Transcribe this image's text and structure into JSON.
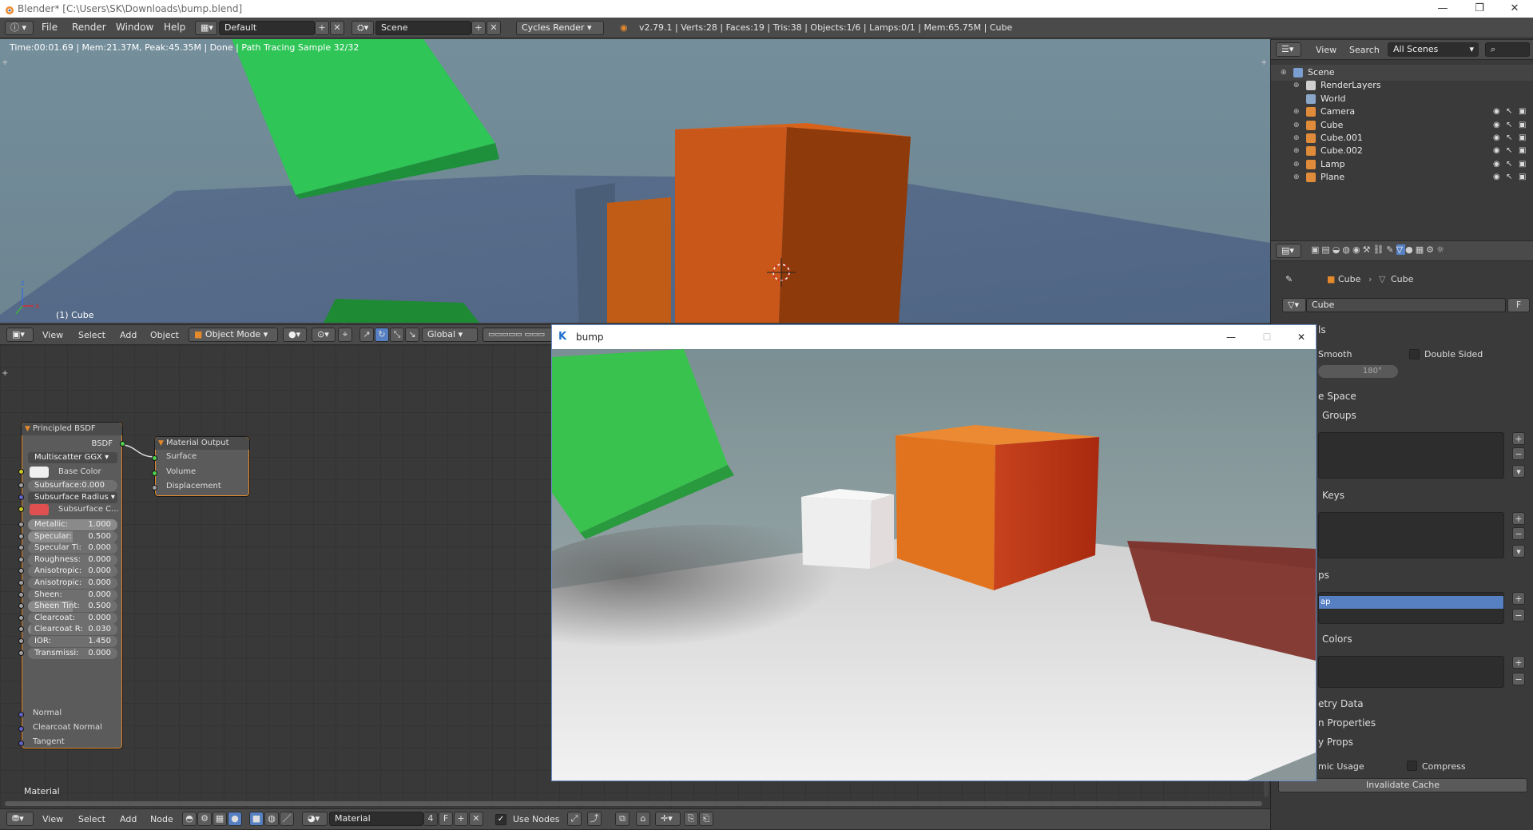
{
  "window": {
    "title": "Blender* [C:\\Users\\SK\\Downloads\\bump.blend]",
    "controls": [
      "—",
      "❐",
      "✕"
    ]
  },
  "info_header": {
    "menus": [
      "File",
      "Render",
      "Window",
      "Help"
    ],
    "layout": "Default",
    "scene": "Scene",
    "engine": "Cycles Render",
    "stats": "v2.79.1 | Verts:28 | Faces:19 | Tris:38 | Objects:1/6 | Lamps:0/1 | Mem:65.75M | Cube"
  },
  "viewport": {
    "render_status": "Time:00:01.69 | Mem:21.37M, Peak:45.35M | Done | Path Tracing Sample 32/32",
    "object_label": "(1) Cube",
    "header": {
      "menus": [
        "View",
        "Select",
        "Add",
        "Object"
      ],
      "mode": "Object Mode",
      "orientation": "Global"
    }
  },
  "node_editor": {
    "label": "Material",
    "principled": {
      "title": "Principled BSDF",
      "output": "BSDF",
      "distribution": "Multiscatter GGX",
      "base_color": "Base Color",
      "subsurface": "Subsurface:",
      "subsurface_val": "0.000",
      "subsurface_radius": "Subsurface Radius",
      "subsurface_color": "Subsurface C...",
      "params": [
        {
          "label": "Metallic:",
          "value": "1.000",
          "fill": 1.0
        },
        {
          "label": "Specular:",
          "value": "0.500",
          "fill": 0.5
        },
        {
          "label": "Specular Ti:",
          "value": "0.000",
          "fill": 0
        },
        {
          "label": "Roughness:",
          "value": "0.000",
          "fill": 0
        },
        {
          "label": "Anisotropic:",
          "value": "0.000",
          "fill": 0
        },
        {
          "label": "Anisotropic:",
          "value": "0.000",
          "fill": 0
        },
        {
          "label": "Sheen:",
          "value": "0.000",
          "fill": 0
        },
        {
          "label": "Sheen Tint:",
          "value": "0.500",
          "fill": 0.5
        },
        {
          "label": "Clearcoat:",
          "value": "0.000",
          "fill": 0
        },
        {
          "label": "Clearcoat R:",
          "value": "0.030",
          "fill": 0.03
        },
        {
          "label": "IOR:",
          "value": "1.450",
          "fill": 0
        },
        {
          "label": "Transmissi:",
          "value": "0.000",
          "fill": 0
        }
      ],
      "inputs": [
        "Normal",
        "Clearcoat Normal",
        "Tangent"
      ]
    },
    "output": {
      "title": "Material Output",
      "sockets": [
        "Surface",
        "Volume",
        "Displacement"
      ]
    },
    "header": {
      "menus": [
        "View",
        "Select",
        "Add",
        "Node"
      ],
      "material": "Material",
      "users": "4",
      "fake": "F",
      "use_nodes": "Use Nodes"
    }
  },
  "outliner": {
    "menus": [
      "View",
      "Search"
    ],
    "filter": "All Scenes",
    "items": [
      {
        "label": "Scene",
        "icon": "scene-icon",
        "color": "#7a9fd0"
      },
      {
        "label": "RenderLayers",
        "icon": "render-layers-icon",
        "color": "#cfcfcf"
      },
      {
        "label": "World",
        "icon": "world-icon",
        "color": "#8aa7c9"
      },
      {
        "label": "Camera",
        "icon": "camera-icon",
        "color": "#e08b3a"
      },
      {
        "label": "Cube",
        "icon": "mesh-icon",
        "color": "#e08b3a"
      },
      {
        "label": "Cube.001",
        "icon": "mesh-icon",
        "color": "#e08b3a"
      },
      {
        "label": "Cube.002",
        "icon": "mesh-icon",
        "color": "#e08b3a"
      },
      {
        "label": "Lamp",
        "icon": "lamp-icon",
        "color": "#e08b3a"
      },
      {
        "label": "Plane",
        "icon": "mesh-icon",
        "color": "#e08b3a"
      }
    ]
  },
  "properties": {
    "breadcrumb": [
      "Cube",
      "Cube"
    ],
    "mesh_name": "Cube",
    "fake": "F",
    "sections": {
      "normals_tail": "ls",
      "smooth": "Smooth",
      "double_sided": "Double Sided",
      "angle": "180°",
      "texture_space": "e Space",
      "groups": "Groups",
      "keys": "Keys",
      "uvmaps": "ps",
      "uv_item": "ap",
      "colors": "Colors",
      "geometry": "etry Data",
      "custom": "n Properties",
      "props": "y Props",
      "dynamic": "mic Usage",
      "compress": "Compress",
      "invalidate": "Invalidate Cache"
    }
  },
  "render_window": {
    "title": "bump",
    "controls": [
      "—",
      "☐",
      "✕"
    ]
  },
  "colors": {
    "accent": "#e58a2c",
    "blue_selected": "#5680c2",
    "green_cube": "#2ecc55",
    "orange_cube": "#d9621a"
  }
}
